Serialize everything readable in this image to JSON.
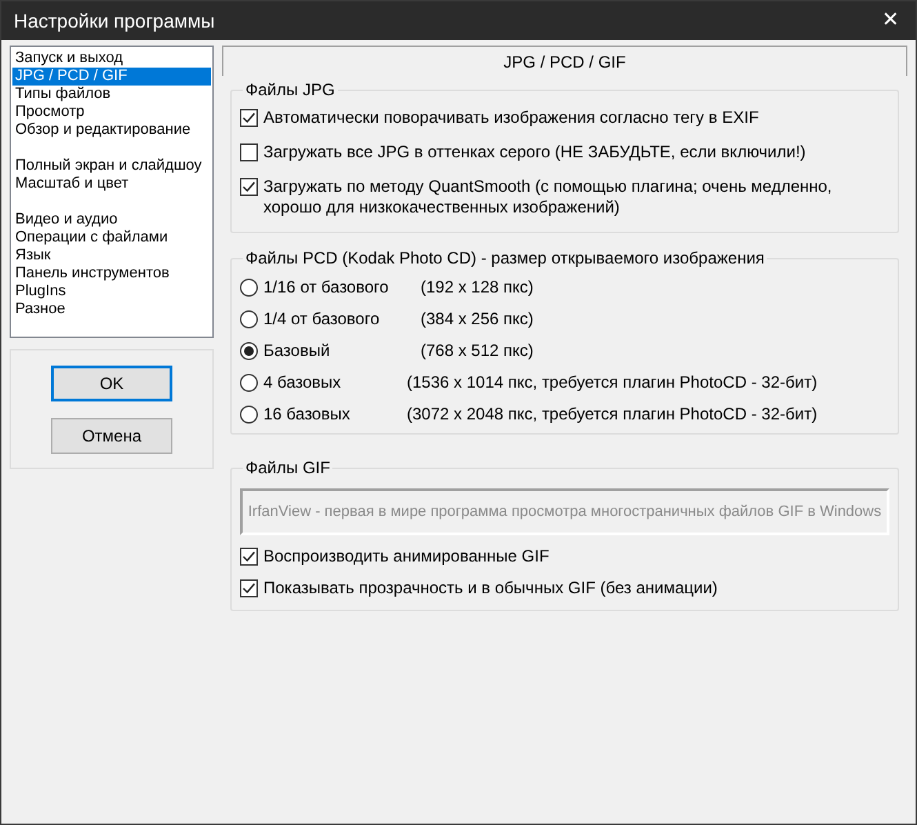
{
  "window": {
    "title": "Настройки программы",
    "close": "✕"
  },
  "sidebar": {
    "groups": [
      {
        "items": [
          {
            "label": "Запуск и выход",
            "selected": false
          },
          {
            "label": "JPG / PCD / GIF",
            "selected": true
          },
          {
            "label": "Типы файлов",
            "selected": false
          },
          {
            "label": "Просмотр",
            "selected": false
          },
          {
            "label": "Обзор и редактирование",
            "selected": false
          }
        ]
      },
      {
        "items": [
          {
            "label": "Полный экран и слайдшоу",
            "selected": false
          },
          {
            "label": "Масштаб и цвет",
            "selected": false
          }
        ]
      },
      {
        "items": [
          {
            "label": "Видео и аудио",
            "selected": false
          },
          {
            "label": "Операции с файлами",
            "selected": false
          },
          {
            "label": "Язык",
            "selected": false
          },
          {
            "label": "Панель инструментов",
            "selected": false
          },
          {
            "label": "PlugIns",
            "selected": false
          },
          {
            "label": "Разное",
            "selected": false
          }
        ]
      }
    ]
  },
  "buttons": [
    {
      "label": "OK",
      "default": true
    },
    {
      "label": "Отмена",
      "default": false
    }
  ],
  "page_title": "JPG / PCD / GIF",
  "jpg_group": {
    "title": "Файлы JPG",
    "options": [
      {
        "label": "Автоматически поворачивать изображения согласно тегу в EXIF",
        "checked": true
      },
      {
        "label": "Загружать все JPG в оттенках серого (НЕ ЗАБУДЬТЕ, если включили!)",
        "checked": false
      },
      {
        "label": "Загружать по методу QuantSmooth (с помощью плагина; очень медленно, хорошо для низкокачественных изображений)",
        "checked": true
      }
    ]
  },
  "pcd_group": {
    "title": "Файлы PCD (Kodak Photo CD) - размер открываемого изображения",
    "options": [
      {
        "label": "1/16 от базового",
        "detail": "(192 x 128 пкс)",
        "selected": false
      },
      {
        "label": "1/4 от базового",
        "detail": "(384 x 256 пкс)",
        "selected": false
      },
      {
        "label": "Базовый",
        "detail": "(768 x 512 пкс)",
        "selected": true
      },
      {
        "label": "4 базовых",
        "detail": "(1536 x 1014 пкс, требуется плагин PhotoCD - 32-бит)",
        "selected": false
      },
      {
        "label": "16 базовых",
        "detail": "(3072 x 2048 пкс, требуется плагин PhotoCD - 32-бит)",
        "selected": false
      }
    ]
  },
  "gif_group": {
    "title": "Файлы GIF",
    "notice": "IrfanView - первая в мире программа просмотра многостраничных файлов GIF в Windows",
    "options": [
      {
        "label": "Воспроизводить анимированные GIF",
        "checked": true
      },
      {
        "label": "Показывать прозрачность и в обычных GIF (без анимации)",
        "checked": true
      }
    ]
  }
}
